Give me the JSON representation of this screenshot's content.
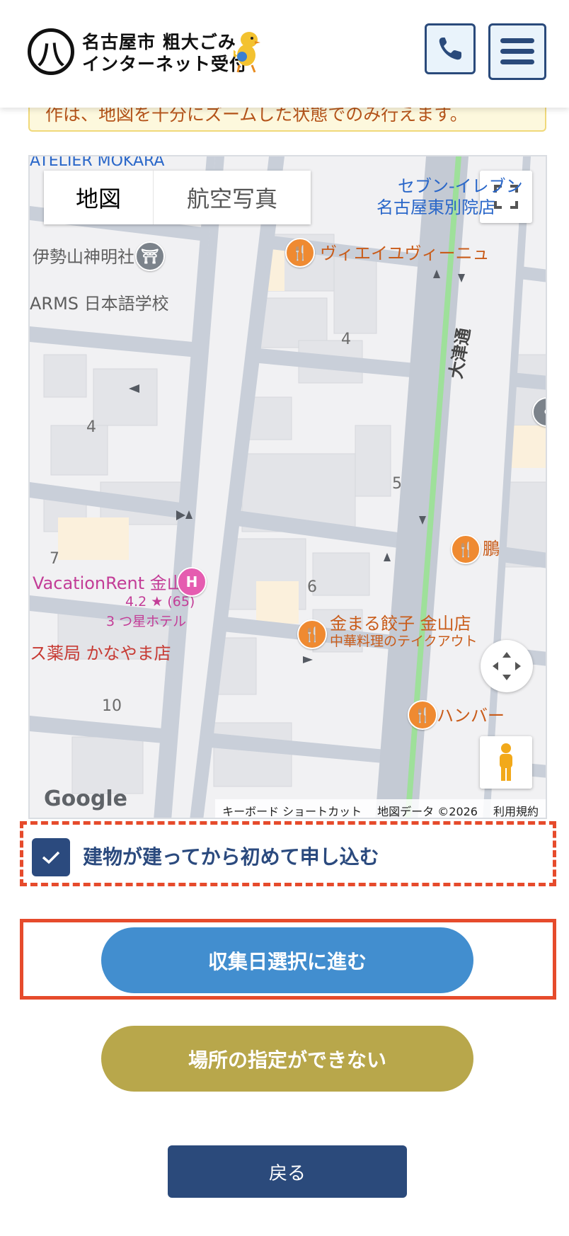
{
  "header": {
    "logo_mark": "八",
    "title_line1": "名古屋市 粗大ごみ",
    "title_line2": "インターネット受付",
    "phone_icon": "phone-icon",
    "menu_icon": "hamburger-icon"
  },
  "notice": {
    "text": "作は、地図を十分にズームした状態でのみ行えます。"
  },
  "map": {
    "type_buttons": {
      "map": "地図",
      "satellite": "航空写真"
    },
    "labels": {
      "atelier": "ATELIER MOKARA",
      "seven_line1": "セブン-イレブン",
      "seven_line2": "名古屋東別院店",
      "shrine": "伊勢山神明社",
      "school": "ARMS 日本語学校",
      "restaurant1": "ヴィエイユヴィーニュ",
      "street": "大津通",
      "block4a": "4",
      "block4b": "4",
      "block5": "5",
      "block6": "6",
      "block7": "7",
      "block10": "10",
      "hotel_name": "VacationRent 金山",
      "hotel_rating": "4.2 ★ (65)",
      "hotel_type": "3 つ星ホテル",
      "gyoza_name": "金まる餃子 金山店",
      "gyoza_sub": "中華料理のテイクアウト",
      "pharmacy": "ス薬局 かなやま店",
      "right_food1": "鵬",
      "right_food2": "ハンバー"
    },
    "google_logo": "Google",
    "attribution": {
      "shortcuts": "キーボード ショートカット",
      "data": "地図データ ©2026",
      "terms": "利用規約"
    }
  },
  "checkbox": {
    "checked": true,
    "label": "建物が建ってから初めて申し込む"
  },
  "buttons": {
    "proceed": "収集日選択に進む",
    "no_location": "場所の指定ができない",
    "back": "戻る"
  },
  "colors": {
    "navy": "#2b4a7b",
    "blue": "#428ecf",
    "olive": "#b8a74b",
    "highlight_red": "#e64b2c",
    "notice_bg": "#fdf8dd"
  }
}
